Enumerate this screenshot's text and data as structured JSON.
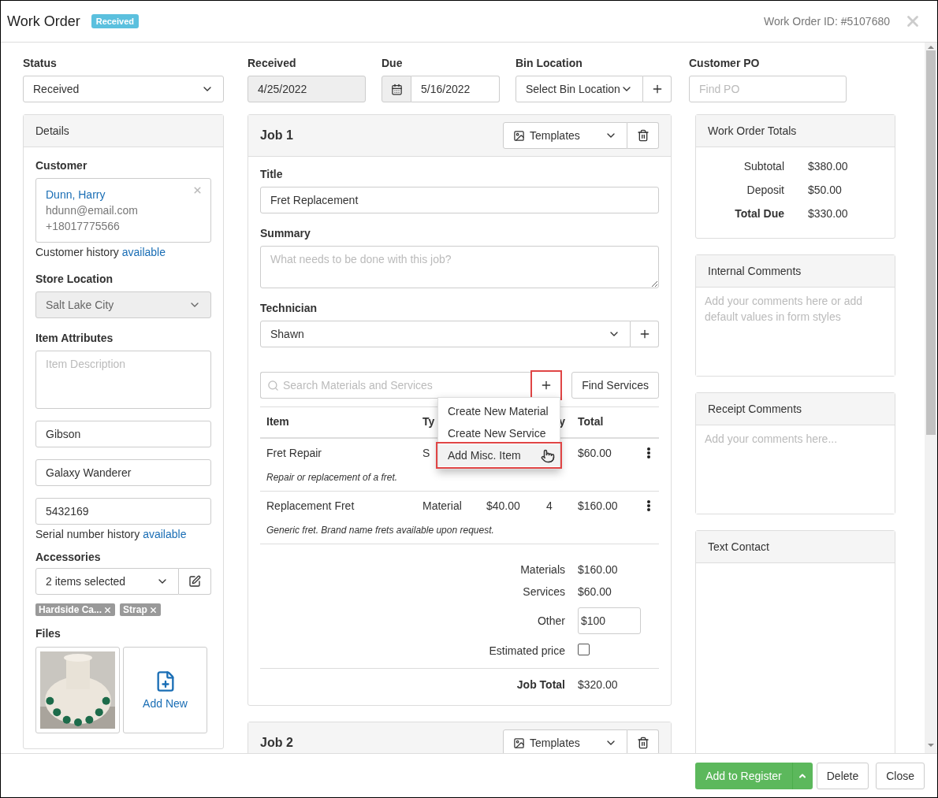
{
  "header": {
    "title": "Work Order",
    "badge": "Received",
    "order_id": "Work Order ID: #5107680"
  },
  "fields": {
    "status": {
      "label": "Status",
      "value": "Received"
    },
    "received": {
      "label": "Received",
      "value": "4/25/2022",
      "disabled": true
    },
    "due": {
      "label": "Due",
      "value": "5/16/2022"
    },
    "bin": {
      "label": "Bin Location",
      "value": "Select Bin Location"
    },
    "po": {
      "label": "Customer PO",
      "placeholder": "Find PO"
    }
  },
  "details": {
    "title": "Details",
    "customer_label": "Customer",
    "customer": {
      "name": "Dunn, Harry",
      "email": "hdunn@email.com",
      "phone": "+18017775566"
    },
    "customer_history": {
      "text": "Customer history",
      "link": "available"
    },
    "store_label": "Store Location",
    "store": {
      "value": "Salt Lake City",
      "disabled": true
    },
    "attributes_label": "Item Attributes",
    "description_placeholder": "Item Description",
    "attributes": [
      "Gibson",
      "Galaxy Wanderer",
      "5432169"
    ],
    "serial_history": {
      "text": "Serial number history",
      "link": "available"
    },
    "accessories_label": "Accessories",
    "accessories_value": "2 items selected",
    "tags": [
      "Hardside Ca...",
      "Strap"
    ],
    "files_label": "Files",
    "files": [
      {
        "kind": "picture"
      },
      {
        "kind": "add",
        "label": "Add New"
      }
    ]
  },
  "jobs": [
    {
      "title": "Job 1",
      "templates": "Templates",
      "title_label": "Title",
      "title_value": "Fret Replacement",
      "summary_label": "Summary",
      "summary_placeholder": "What needs to be done with this job?",
      "technician_label": "Technician",
      "technician": "Shawn",
      "search_placeholder": "Search Materials and Services",
      "add_highlighted": true,
      "find_services": "Find Services",
      "menu": [
        {
          "label": "Create New Material",
          "highlighted": false
        },
        {
          "label": "Create New Service",
          "highlighted": false
        },
        {
          "label": "Add Misc. Item",
          "highlighted": true
        }
      ],
      "columns": [
        "Item",
        "Ty",
        "y",
        "Total"
      ],
      "rows": [
        {
          "item": "Fret Repair",
          "type": "S",
          "total": "$60.00",
          "description": "Repair or replacement of a fret."
        },
        {
          "item": "Replacement Fret",
          "type": "Material",
          "price": "$40.00",
          "qty": "4",
          "total": "$160.00",
          "description": "Generic fret. Brand name frets available upon request."
        }
      ],
      "materials_label": "Materials",
      "materials": "$160.00",
      "services_label": "Services",
      "services": "$60.00",
      "other_label": "Other",
      "other": "$100",
      "estimated_label": "Estimated price",
      "estimated_checked": false,
      "job_total_label": "Job Total",
      "job_total": "$320.00"
    },
    {
      "title": "Job 2",
      "templates": "Templates"
    }
  ],
  "totals": {
    "title": "Work Order Totals",
    "rows": [
      {
        "label": "Subtotal",
        "value": "$380.00",
        "bold": false
      },
      {
        "label": "Deposit",
        "value": "$50.00",
        "bold": false
      },
      {
        "label": "Total Due",
        "value": "$330.00",
        "bold": true
      }
    ]
  },
  "comments": [
    {
      "title": "Internal Comments",
      "placeholder": "Add your comments here or add default values in form styles"
    },
    {
      "title": "Receipt Comments",
      "placeholder": "Add your comments here..."
    },
    {
      "title": "Text Contact"
    }
  ],
  "footer": [
    {
      "label": "Add to Register",
      "kind": "split"
    },
    {
      "label": "Delete",
      "kind": "plain"
    },
    {
      "label": "Close",
      "kind": "plain"
    }
  ]
}
